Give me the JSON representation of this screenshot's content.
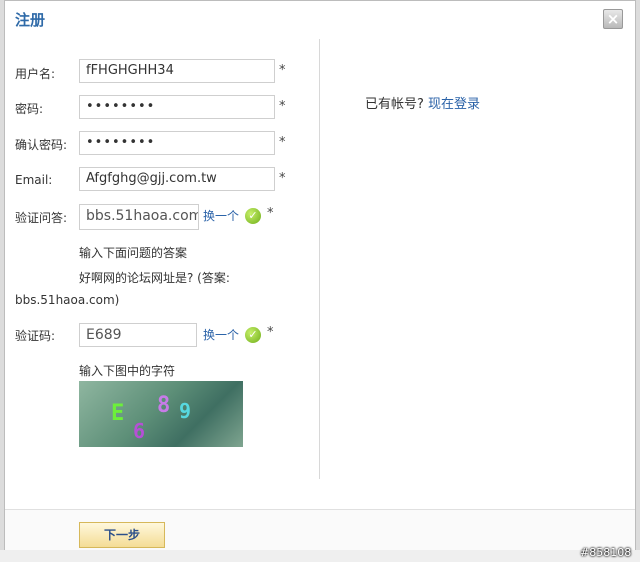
{
  "dialog": {
    "title": "注册",
    "close_label": "×"
  },
  "form": {
    "username": {
      "label": "用户名:",
      "value": "fFHGHGHH34",
      "required": "*"
    },
    "password": {
      "label": "密码:",
      "value": "••••••••",
      "required": "*"
    },
    "confirm_password": {
      "label": "确认密码:",
      "value": "••••••••",
      "required": "*"
    },
    "email": {
      "label": "Email:",
      "value": "Afgfghg@gjj.com.tw",
      "required": "*"
    },
    "question": {
      "label": "验证问答:",
      "value": "bbs.51haoa.com",
      "change_label": "换一个",
      "check": "✓",
      "required": "*",
      "hint": "输入下面问题的答案",
      "question_line1": "好啊网的论坛网址是? (答案:",
      "question_line2": "bbs.51haoa.com)"
    },
    "captcha": {
      "label": "验证码:",
      "value": "E689",
      "change_label": "换一个",
      "check": "✓",
      "required": "*",
      "hint": "输入下图中的字符",
      "chars": [
        "E",
        "6",
        "8",
        "9"
      ]
    }
  },
  "sidebar": {
    "prompt": "已有帐号?",
    "login_link": "现在登录"
  },
  "footer": {
    "next_label": "下一步"
  },
  "watermark": "#858108",
  "colors": {
    "title": "#2f6aa8",
    "link": "#2a62a8",
    "check": "#6fae19"
  }
}
